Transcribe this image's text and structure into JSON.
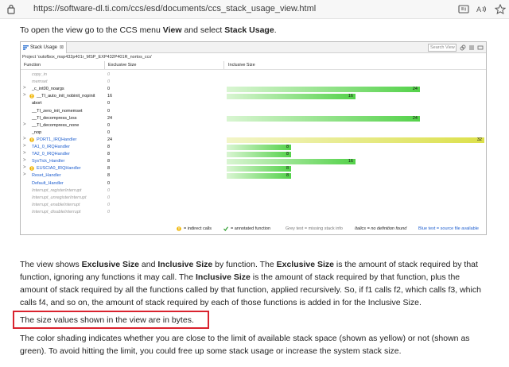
{
  "browser": {
    "url": "https://software-dl.ti.com/ccs/esd/documents/ccs_stack_usage_view.html"
  },
  "intro": {
    "p1": "To open the view go to the CCS menu ",
    "b1": "View",
    "p2": " and select ",
    "b2": "Stack Usage",
    "p3": "."
  },
  "view": {
    "tab_label": "Stack Usage",
    "tab_close": "⊠",
    "search_placeholder": "Search View",
    "project_line": "Project 'outofbox_msp432p401r_MSP_EXP432P401R_nortos_ccs'",
    "columns": [
      "Function",
      "Exclusive Size",
      "Inclusive Size"
    ],
    "rows": [
      {
        "expander": "",
        "indirect": false,
        "name": "copy_in",
        "style": "grey",
        "exclusive": "0",
        "inclusive": null
      },
      {
        "expander": "",
        "indirect": false,
        "name": "memset",
        "style": "grey",
        "exclusive": "0",
        "inclusive": null
      },
      {
        "expander": ">",
        "indirect": false,
        "name": "_c_int00_noargs",
        "style": "normal",
        "exclusive": "0",
        "inclusive": 24
      },
      {
        "expander": ">",
        "indirect": true,
        "name": "__TI_auto_init_nobinit_nopinit",
        "style": "normal",
        "exclusive": "16",
        "inclusive": 16
      },
      {
        "expander": "",
        "indirect": false,
        "name": "abort",
        "style": "normal",
        "exclusive": "0",
        "inclusive": null
      },
      {
        "expander": "",
        "indirect": false,
        "name": "__TI_zero_init_nomemset",
        "style": "normal",
        "exclusive": "0",
        "inclusive": null
      },
      {
        "expander": "",
        "indirect": false,
        "name": "__TI_decompress_lzss",
        "style": "normal",
        "exclusive": "24",
        "inclusive": 24
      },
      {
        "expander": ">",
        "indirect": false,
        "name": "__TI_decompress_none",
        "style": "normal",
        "exclusive": "0",
        "inclusive": null
      },
      {
        "expander": "",
        "indirect": false,
        "name": "_nop",
        "style": "normal",
        "exclusive": "0",
        "inclusive": null
      },
      {
        "expander": ">",
        "indirect": true,
        "name": "PORT1_IRQHandler",
        "style": "blue",
        "exclusive": "24",
        "inclusive": 32
      },
      {
        "expander": ">",
        "indirect": false,
        "name": "TA1_0_IRQHandler",
        "style": "blue",
        "exclusive": "8",
        "inclusive": 8
      },
      {
        "expander": ">",
        "indirect": false,
        "name": "TA2_0_IRQHandler",
        "style": "blue",
        "exclusive": "8",
        "inclusive": 8
      },
      {
        "expander": ">",
        "indirect": false,
        "name": "SysTick_Handler",
        "style": "blue",
        "exclusive": "8",
        "inclusive": 16
      },
      {
        "expander": ">",
        "indirect": true,
        "name": "EUSCIA0_IRQHandler",
        "style": "blue",
        "exclusive": "8",
        "inclusive": 8
      },
      {
        "expander": ">",
        "indirect": false,
        "name": "Reset_Handler",
        "style": "blue",
        "exclusive": "8",
        "inclusive": 8
      },
      {
        "expander": "",
        "indirect": false,
        "name": "Default_Handler",
        "style": "blue",
        "exclusive": "0",
        "inclusive": null
      },
      {
        "expander": "",
        "indirect": false,
        "name": "Interrupt_registerInterrupt",
        "style": "grey",
        "exclusive": "0",
        "inclusive": null
      },
      {
        "expander": "",
        "indirect": false,
        "name": "Interrupt_unregisterInterrupt",
        "style": "grey",
        "exclusive": "0",
        "inclusive": null
      },
      {
        "expander": "",
        "indirect": false,
        "name": "Interrupt_enableInterrupt",
        "style": "grey",
        "exclusive": "0",
        "inclusive": null
      },
      {
        "expander": "",
        "indirect": false,
        "name": "Interrupt_disableInterrupt",
        "style": "grey",
        "exclusive": "0",
        "inclusive": null
      }
    ],
    "inclusive_max": 32,
    "stack_limit_color": "#dce04a",
    "ok_color": "#54d24a",
    "legend": {
      "indirect": "= indirect calls",
      "annotated": "= annotated function",
      "grey": "Grey text = missing stack info",
      "italic": "Italics = no definition found",
      "blue": "Blue text = source file available"
    }
  },
  "body": {
    "p1_l1_a": "The view shows ",
    "p1_l1_b": "Exclusive Size",
    "p1_l1_c": " and ",
    "p1_l1_d": "Inclusive Size",
    "p1_l1_e": " by function. The ",
    "p1_l1_f": "Exclusive Size",
    "p1_l1_g": " is the amount of stack required by that",
    "p1_l2_a": "function, ignoring any functions it may call. The ",
    "p1_l2_b": "Inclusive Size",
    "p1_l2_c": " is the amount of stack required by that function, plus the",
    "p1_l3": "amount of stack required by all the functions called by that function, applied recursively. So, if f1 calls f2, which calls f3, which",
    "p1_l4": "calls f4, and so on, the amount of stack required by each of those functions is added in for the Inclusive Size.",
    "p2": "The size values shown in the view are in bytes.",
    "p3_l1": "The color shading indicates whether you are close to the limit of available stack space (shown as yellow) or not (shown as",
    "p3_l2": "green). To avoid hitting the limit, you could free up some stack usage or increase the system stack size."
  }
}
